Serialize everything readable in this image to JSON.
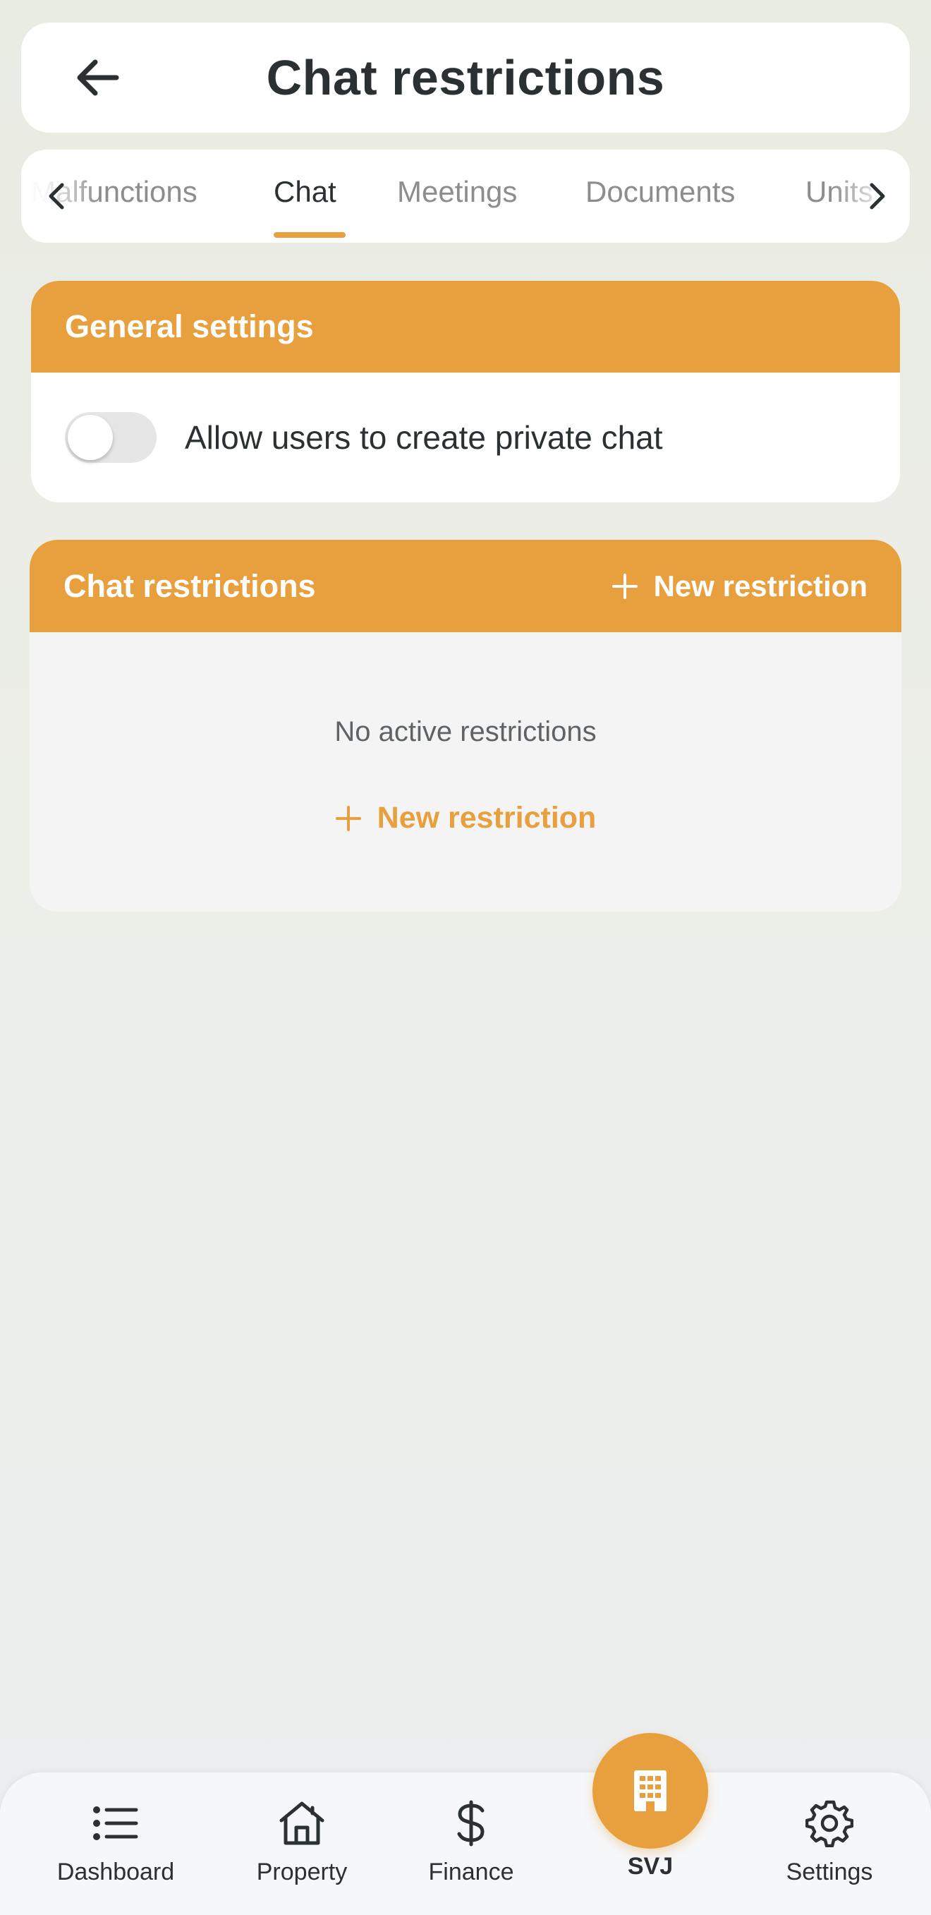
{
  "header": {
    "title": "Chat restrictions"
  },
  "tabs": [
    {
      "label": "Malfunctions"
    },
    {
      "label": "Chat"
    },
    {
      "label": "Meetings"
    },
    {
      "label": "Documents"
    },
    {
      "label": "Units"
    }
  ],
  "active_tab": "Chat",
  "general_settings": {
    "title": "General settings",
    "toggle_label": "Allow users to create private chat",
    "toggle_on": false
  },
  "chat_restrictions": {
    "title": "Chat restrictions",
    "header_button": "New restriction",
    "empty_text": "No active restrictions",
    "empty_button": "New restriction"
  },
  "bottom_nav": {
    "items": [
      {
        "label": "Dashboard",
        "icon": "list-icon"
      },
      {
        "label": "Property",
        "icon": "house-icon"
      },
      {
        "label": "Finance",
        "icon": "dollar-icon"
      },
      {
        "label": "SVJ",
        "icon": "building-icon"
      },
      {
        "label": "Settings",
        "icon": "gear-icon"
      }
    ]
  },
  "colors": {
    "accent": "#e8a03e",
    "text": "#2b3033",
    "muted": "#8b8d8f"
  }
}
